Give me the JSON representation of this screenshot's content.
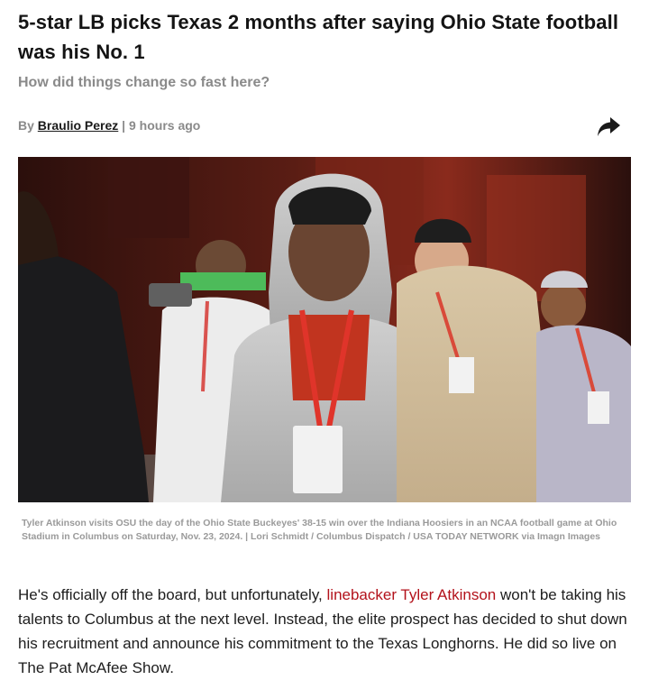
{
  "article": {
    "headline": "5-star LB picks Texas 2 months after saying Ohio State football was his No. 1",
    "subheadline": "How did things change so fast here?",
    "byline": {
      "prefix": "By",
      "author": "Braulio Perez",
      "separator": "|",
      "time": "9 hours ago"
    },
    "share_icon": "share-arrow-icon",
    "image_caption": "Tyler Atkinson visits OSU the day of the Ohio State Buckeyes' 38-15 win over the Indiana Hoosiers in an NCAA football game at Ohio Stadium in Columbus on Saturday, Nov. 23, 2024. | Lori Schmidt / Columbus Dispatch / USA TODAY NETWORK via Imagn Images",
    "body": {
      "text_before_link": "He's officially off the board, but unfortunately, ",
      "link_text": "linebacker Tyler Atkinson",
      "text_after_link": " won't be taking his talents to Columbus at the next level. Instead, the elite prospect has decided to shut down his recruitment and announce his commitment to the Texas Longhorns. He did so live on The Pat McAfee Show."
    }
  },
  "colors": {
    "link": "#b3121b",
    "muted": "#8a8a8a",
    "headline": "#141414"
  }
}
